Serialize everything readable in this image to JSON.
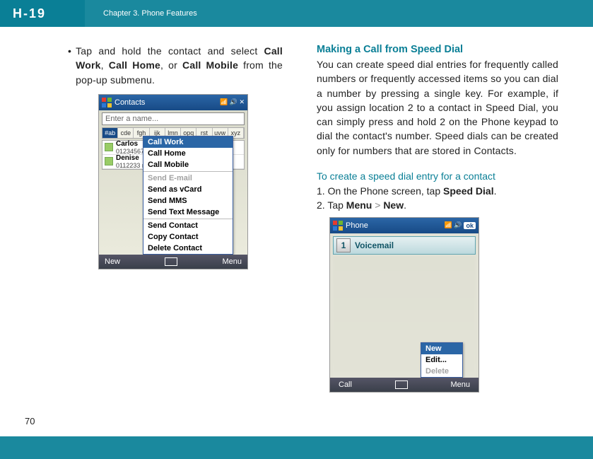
{
  "header": {
    "logo": "H-19",
    "chapter": "Chapter 3. Phone Features"
  },
  "left": {
    "bullet_intro": "Tap and hold the contact and select ",
    "call_work": "Call Work",
    "sep1": ", ",
    "call_home": "Call Home",
    "sep2": ", or ",
    "call_mobile": "Call Mobile",
    "bullet_end": " from the pop-up submenu."
  },
  "shot1": {
    "title": "Contacts",
    "placeholder": "Enter a name...",
    "alpha": [
      "#ab",
      "cde",
      "fgh",
      "ijk",
      "lmn",
      "opq",
      "rst",
      "uvw",
      "xyz"
    ],
    "rows": [
      {
        "name": "Carlos",
        "num": "01234567890  m"
      },
      {
        "name": "Denise",
        "num": "0112233  m"
      }
    ],
    "menu": [
      "Call Work",
      "Call Home",
      "Call Mobile",
      "Send E-mail",
      "Send as vCard",
      "Send MMS",
      "Send Text Message",
      "Send Contact",
      "Copy Contact",
      "Delete Contact"
    ],
    "soft_left": "New",
    "soft_right": "Menu"
  },
  "right": {
    "title": "Making a Call from Speed Dial",
    "body": "You can create speed dial entries for frequently called numbers or frequently accessed items so you can dial a number by pressing a single key. For example, if you assign location 2 to a contact in Speed Dial, you can simply press and hold 2 on the Phone keypad to dial the contact's number. Speed dials can be created only for numbers that are stored in Contacts.",
    "subtitle": "To create a speed dial entry for a contact",
    "step1_a": "1. On the Phone screen, tap ",
    "step1_b": "Speed Dial",
    "step1_c": ".",
    "step2_a": "2. Tap ",
    "step2_b": "Menu",
    "step2_c": " > ",
    "step2_d": "New",
    "step2_e": "."
  },
  "shot2": {
    "title": "Phone",
    "ok": "ok",
    "voicemail_num": "1",
    "voicemail": "Voicemail",
    "menu": [
      "New",
      "Edit...",
      "Delete"
    ],
    "soft_left": "Call",
    "soft_right": "Menu"
  },
  "page_number": "70"
}
